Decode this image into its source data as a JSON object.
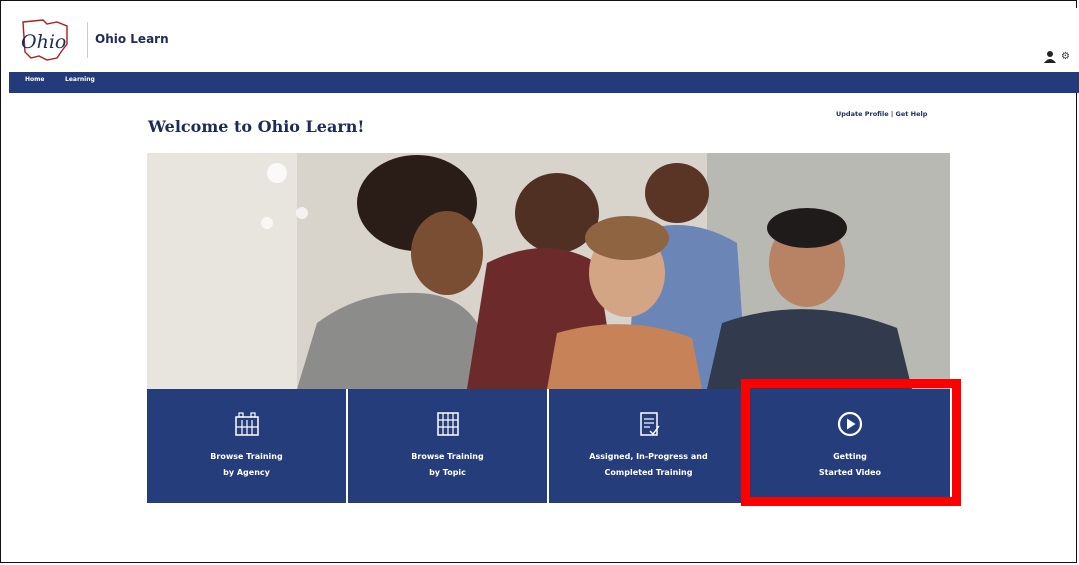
{
  "header": {
    "app_title": "Ohio Learn",
    "logo_text": "Ohio"
  },
  "nav": {
    "items": [
      {
        "label": "Home"
      },
      {
        "label": "Learning"
      }
    ]
  },
  "main": {
    "welcome_title": "Welcome to Ohio Learn!",
    "links": {
      "update_profile": "Update Profile",
      "separator": "|",
      "get_help": "Get Help"
    }
  },
  "tiles": [
    {
      "line1": "Browse Training",
      "line2": "by Agency",
      "icon": "agency-building-icon"
    },
    {
      "line1": "Browse Training",
      "line2": "by Topic",
      "icon": "topic-grid-icon"
    },
    {
      "line1": "Assigned, In-Progress and",
      "line2": "Completed Training",
      "icon": "assigned-document-icon"
    },
    {
      "line1": "Getting",
      "line2": "Started Video",
      "icon": "play-icon"
    }
  ],
  "colors": {
    "brand_navy": "#263d7c",
    "nav_bar": "#233a7b",
    "highlight": "#ff0000",
    "title": "#1d2b5b"
  }
}
